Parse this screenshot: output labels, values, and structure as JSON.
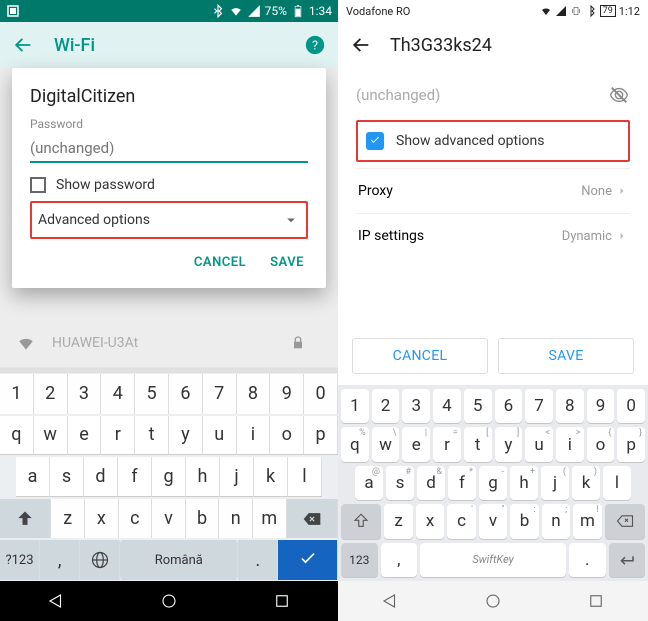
{
  "left": {
    "status": {
      "battery_pct": "75%",
      "time": "1:34"
    },
    "appbar": {
      "title": "Wi-Fi"
    },
    "bg_network": {
      "name": "HUAWEI-U3At"
    },
    "dialog": {
      "title": "DigitalCitizen",
      "password_label": "Password",
      "password_placeholder": "(unchanged)",
      "show_password": "Show password",
      "advanced": "Advanced options",
      "cancel": "CANCEL",
      "save": "SAVE"
    },
    "keyboard": {
      "row1": [
        "1",
        "2",
        "3",
        "4",
        "5",
        "6",
        "7",
        "8",
        "9",
        "0"
      ],
      "row2": [
        "q",
        "w",
        "e",
        "r",
        "t",
        "y",
        "u",
        "i",
        "o",
        "p"
      ],
      "row3": [
        "a",
        "s",
        "d",
        "f",
        "g",
        "h",
        "j",
        "k",
        "l"
      ],
      "row4": [
        "z",
        "x",
        "c",
        "v",
        "b",
        "n",
        "m"
      ],
      "symbols": "?123",
      "space": "Română"
    }
  },
  "right": {
    "status": {
      "carrier": "Vodafone RO",
      "battery_pct": "79",
      "time": "1:12"
    },
    "appbar": {
      "title": "Th3G33ks24"
    },
    "password_placeholder": "(unchanged)",
    "advanced": "Show advanced options",
    "proxy": {
      "label": "Proxy",
      "value": "None"
    },
    "ip": {
      "label": "IP settings",
      "value": "Dynamic"
    },
    "cancel": "CANCEL",
    "save": "SAVE",
    "keyboard": {
      "row1": [
        "1",
        "2",
        "3",
        "4",
        "5",
        "6",
        "7",
        "8",
        "9",
        "0"
      ],
      "row2": [
        "q",
        "w",
        "e",
        "r",
        "t",
        "y",
        "u",
        "i",
        "o",
        "p"
      ],
      "row3": [
        "a",
        "s",
        "d",
        "f",
        "g",
        "h",
        "j",
        "k",
        "l"
      ],
      "row4": [
        "z",
        "x",
        "c",
        "v",
        "b",
        "n",
        "m"
      ],
      "space": "SwiftKey"
    }
  }
}
